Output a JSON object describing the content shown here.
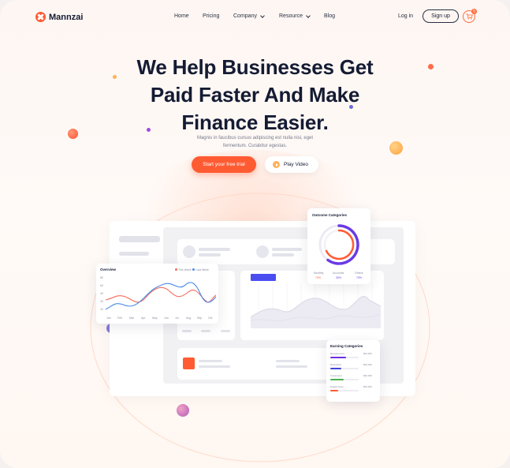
{
  "brand": {
    "name": "Mannzai",
    "accent": "#ff5b33"
  },
  "nav": {
    "items": [
      "Home",
      "Pricing",
      "Company",
      "Resource",
      "Blog"
    ],
    "login": "Log in",
    "signup": "Sign up",
    "cart_count": "0"
  },
  "hero": {
    "title_lines": [
      "We Help Businesses Get",
      "Paid Faster And Make",
      "Finance Easier."
    ],
    "subtitle_lines": [
      "Magnis in faucibus cursus adipiscing est nulla nisi, eget",
      "fermentum. Curabitur egestas."
    ],
    "cta": "Start your free trial",
    "play": "Play Video"
  },
  "overview": {
    "title": "Overview",
    "legend": [
      {
        "name": "This Week",
        "color": "#f26b5b"
      },
      {
        "name": "Last Week",
        "color": "#4a8be8"
      }
    ],
    "y_ticks": [
      "80",
      "60",
      "40",
      "20",
      "10"
    ],
    "x_ticks": [
      "Jan",
      "Feb",
      "Mar",
      "Apr",
      "May",
      "Jun",
      "Jul",
      "Aug",
      "Sep",
      "Oct"
    ]
  },
  "outcome": {
    "title": "Outcome Categories",
    "labels": [
      "Monthly",
      "Accounts",
      "Others"
    ],
    "values": [
      "70%",
      "30%",
      "70%"
    ],
    "ring_colors": [
      "#6a3be4",
      "#ff5b33"
    ]
  },
  "earning": {
    "title": "Earning Categories",
    "rows": [
      {
        "label": "Development",
        "value": "$00,000",
        "color": "#6a2ee0",
        "fill": 0.55
      },
      {
        "label": "Relocation",
        "value": "$00,000",
        "color": "#3f45d8",
        "fill": 0.38
      },
      {
        "label": "Investment",
        "value": "$00,000",
        "color": "#4caf50",
        "fill": 0.48
      },
      {
        "label": "Digital Asset",
        "value": "$00,000",
        "color": "#ff5b33",
        "fill": 0.28
      }
    ]
  }
}
